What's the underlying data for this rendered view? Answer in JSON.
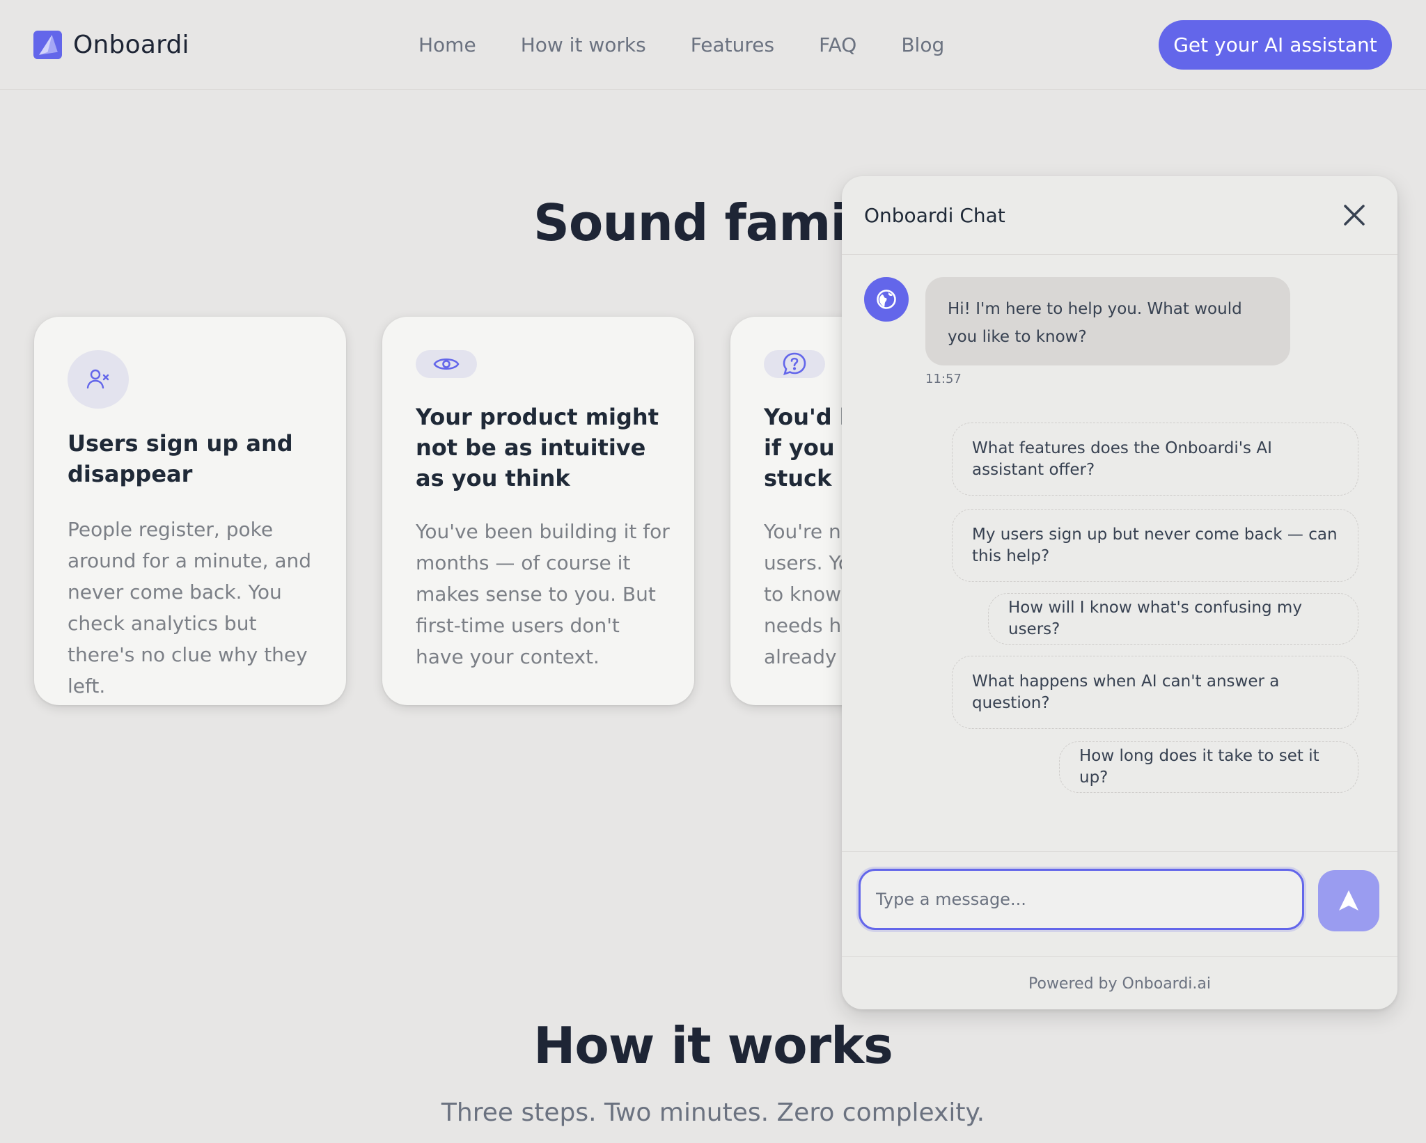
{
  "nav": {
    "brand": "Onboardi",
    "links": [
      "Home",
      "How it works",
      "Features",
      "FAQ",
      "Blog"
    ],
    "cta": "Get your AI assistant"
  },
  "hero": {
    "title": "Sound familia",
    "cards": [
      {
        "icon": "user-x-icon",
        "title": "Users sign up and disappear",
        "text": "People register, poke around for a minute, and never come back. You check analytics but there's no clue why they left."
      },
      {
        "icon": "eye-icon",
        "title": "Your product might not be as intuitive as you think",
        "text": "You've been building it for months — of course it makes sense to you. But first-time users don't have your context."
      },
      {
        "icon": "help-chat-icon",
        "title": "You'd he\nif you kn\nstuck",
        "text": "You're no\nusers. Yo\nto know w\nneeds he\nalready le"
      }
    ]
  },
  "how": {
    "title": "How it works",
    "subtitle": "Three steps. Two minutes. Zero complexity."
  },
  "chat": {
    "title": "Onboardi Chat",
    "bot_message": "Hi! I'm here to help you. What would you like to know?",
    "time": "11:57",
    "suggestions": [
      "What features does the Onboardi's AI assistant offer?",
      "My users sign up but never come back — can this help?",
      "How will I know what's confusing my users?",
      "What happens when AI can't answer a question?",
      "How long does it take to set it up?"
    ],
    "input_placeholder": "Type a message...",
    "powered_by": "Powered by Onboardi.ai"
  },
  "colors": {
    "accent": "#6366ea",
    "background": "#e7e6e5",
    "card": "#f5f5f3",
    "send_button": "#9a9cf0"
  }
}
